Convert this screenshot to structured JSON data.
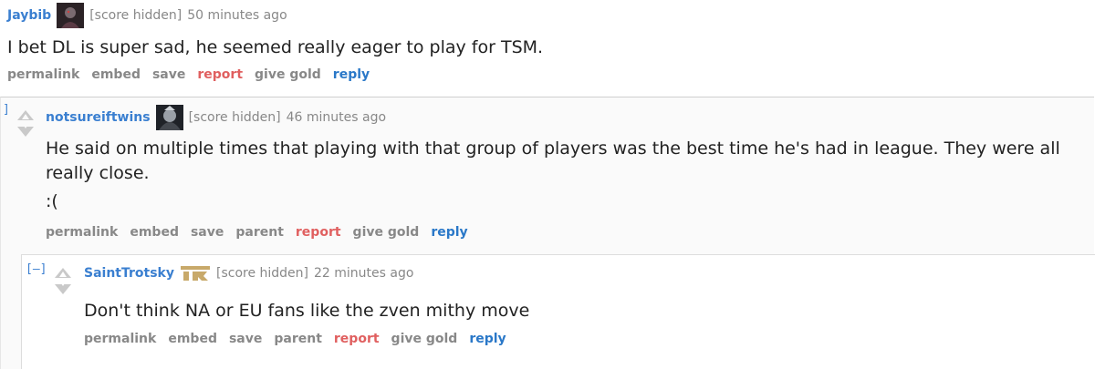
{
  "comments": [
    {
      "author": "Jaybib",
      "score": "[score hidden]",
      "time": "50 minutes ago",
      "body": [
        "I bet DL is super sad, he seemed really eager to play for TSM."
      ],
      "actions": [
        "permalink",
        "embed",
        "save",
        "report",
        "give gold",
        "reply"
      ]
    },
    {
      "collapse": "]",
      "author": "notsureiftwins",
      "score": "[score hidden]",
      "time": "46 minutes ago",
      "body": [
        "He said on multiple times that playing with that group of players was the best time he's had in league. They were all",
        "really close.",
        ":("
      ],
      "actions": [
        "permalink",
        "embed",
        "save",
        "parent",
        "report",
        "give gold",
        "reply"
      ]
    },
    {
      "collapse": "[–]",
      "author": "SaintTrotsky",
      "score": "[score hidden]",
      "time": "22 minutes ago",
      "body": [
        "Don't think NA or EU fans like the zven mithy move"
      ],
      "actions": [
        "permalink",
        "embed",
        "save",
        "parent",
        "report",
        "give gold",
        "reply"
      ]
    }
  ],
  "icons": {
    "avatar1": "dark-champion-avatar",
    "avatar2": "dark-champion-avatar",
    "flair3": "team-rng-logo"
  },
  "colors": {
    "author": "#3a7fd0",
    "meta": "#888888",
    "report": "#e06060",
    "reply": "#2a78c8",
    "flair_gold": "#c8a96a"
  }
}
